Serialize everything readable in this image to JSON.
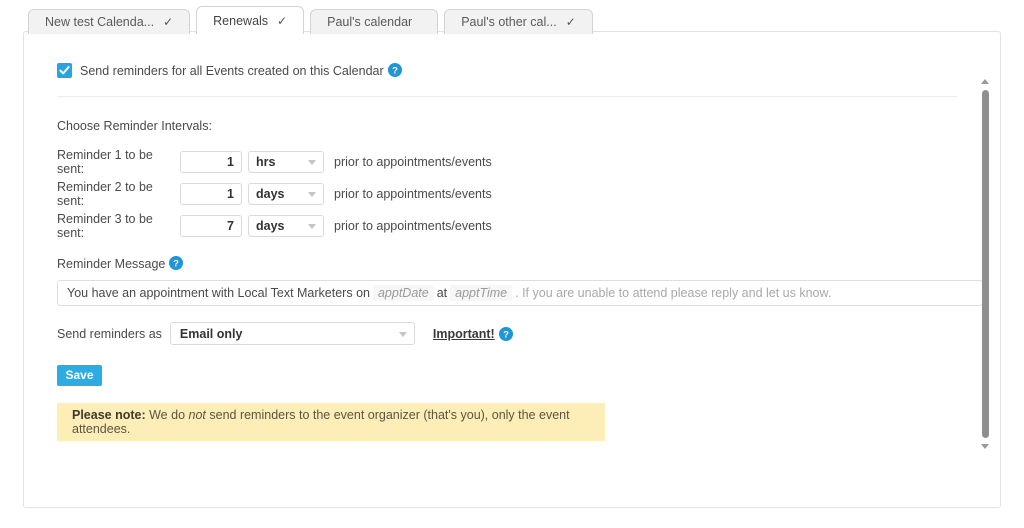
{
  "tabs": [
    {
      "label": "New test Calenda...",
      "check": "✓",
      "active": false
    },
    {
      "label": "Renewals",
      "check": "✓",
      "active": true
    },
    {
      "label": "Paul's calendar",
      "check": "",
      "active": false
    },
    {
      "label": "Paul's other cal...",
      "check": "✓",
      "active": false
    }
  ],
  "form": {
    "send_reminders_label": "Send reminders for all Events created on this Calendar",
    "intervals_label": "Choose Reminder Intervals:",
    "reminders": [
      {
        "label": "Reminder 1 to be sent:",
        "value": "1",
        "unit": "hrs",
        "suffix": "prior to appointments/events"
      },
      {
        "label": "Reminder 2 to be sent:",
        "value": "1",
        "unit": "days",
        "suffix": "prior to appointments/events"
      },
      {
        "label": "Reminder 3 to be sent:",
        "value": "7",
        "unit": "days",
        "suffix": "prior to appointments/events"
      }
    ],
    "message_label": "Reminder Message",
    "message": {
      "part1": "You have an appointment with Local Text Marketers on",
      "token1": "apptDate",
      "part2": "at",
      "token2": "apptTime",
      "part3": ". If you are unable to attend please reply and let us know."
    },
    "send_as_label": "Send reminders as",
    "send_as_value": "Email only",
    "important_label": "Important!",
    "save_label": "Save",
    "note": {
      "strong": "Please note:",
      "text_before": " We do ",
      "emphasis": "not",
      "text_after": " send reminders to the event organizer (that's you), only the event attendees."
    }
  },
  "icons": {
    "help": "help-circle-icon",
    "checkbox_check": "check-icon",
    "scroll_up": "scroll-up-arrow-icon",
    "scroll_down": "scroll-down-arrow-icon"
  },
  "colors": {
    "accent_blue": "#2eabe3",
    "checkbox_blue": "#2aa3e0",
    "note_yellow": "#fdeeb8",
    "tab_inactive": "#f2f2f2"
  }
}
